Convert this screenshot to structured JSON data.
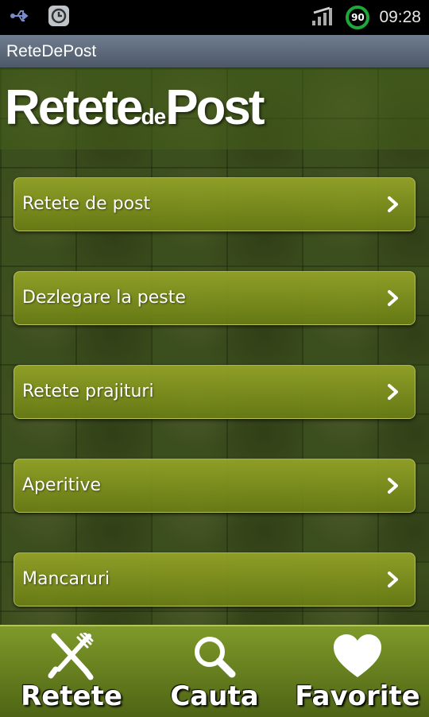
{
  "status_bar": {
    "icons": [
      "usb-icon",
      "alarm-icon",
      "signal-icon"
    ],
    "battery_level": "90",
    "time": "09:28",
    "battery_color": "#1fa83a"
  },
  "app_title": "ReteDePost",
  "logo": {
    "part1": "Retete",
    "part2": "de",
    "part3": "Post"
  },
  "menu": {
    "items": [
      {
        "label": "Retete de post"
      },
      {
        "label": "Dezlegare la peste"
      },
      {
        "label": "Retete prajituri"
      },
      {
        "label": "Aperitive"
      },
      {
        "label": "Mancaruri"
      }
    ],
    "item_icon": "chevron-right-icon"
  },
  "bottom_nav": {
    "items": [
      {
        "label": "Retete",
        "icon": "fork-knife-icon"
      },
      {
        "label": "Cauta",
        "icon": "search-icon"
      },
      {
        "label": "Favorite",
        "icon": "heart-icon"
      }
    ]
  },
  "colors": {
    "accent_green": "#8a9e2a",
    "title_bar": "#5d6a7a"
  }
}
